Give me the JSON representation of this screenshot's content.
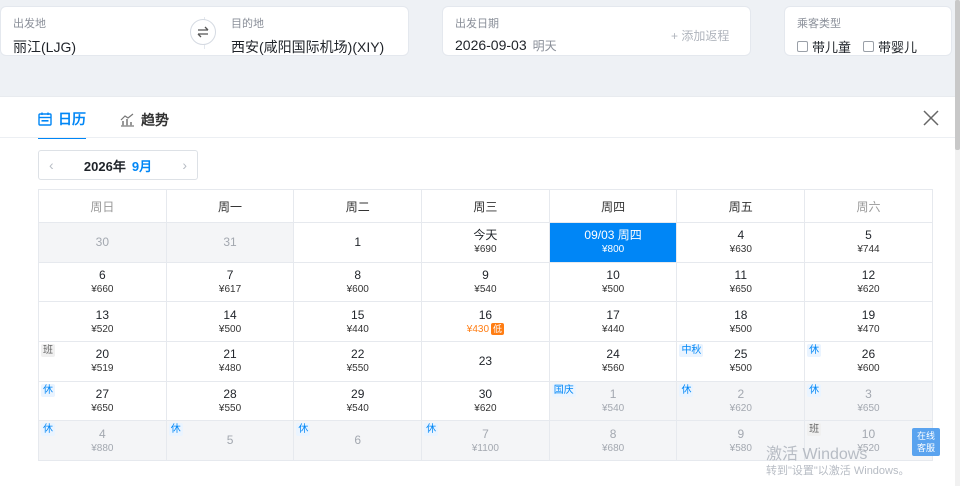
{
  "search": {
    "from_label": "出发地",
    "from_value": "丽江(LJG)",
    "to_label": "目的地",
    "to_value": "西安(咸阳国际机场)(XIY)",
    "date_label": "出发日期",
    "date_value": "2026-09-03",
    "date_sub": "明天",
    "add_return": "+ 添加返程",
    "pax_label": "乘客类型",
    "pax_child": "带儿童",
    "pax_infant": "带婴儿"
  },
  "tabs": {
    "calendar": "日历",
    "trend": "趋势"
  },
  "nav": {
    "year": "2026年",
    "month": "9月",
    "prev": "‹",
    "next": "›"
  },
  "weekdays": [
    "周日",
    "周一",
    "周二",
    "周三",
    "周四",
    "周五",
    "周六"
  ],
  "weeks": [
    [
      {
        "day": "30",
        "price": "",
        "grey": true
      },
      {
        "day": "31",
        "price": "",
        "grey": true
      },
      {
        "day": "1",
        "price": ""
      },
      {
        "day": "今天",
        "price": "¥690"
      },
      {
        "day": "09/03 周四",
        "price": "¥800",
        "selected": true
      },
      {
        "day": "4",
        "price": "¥630"
      },
      {
        "day": "5",
        "price": "¥744"
      }
    ],
    [
      {
        "day": "6",
        "price": "¥660"
      },
      {
        "day": "7",
        "price": "¥617"
      },
      {
        "day": "8",
        "price": "¥600"
      },
      {
        "day": "9",
        "price": "¥540"
      },
      {
        "day": "10",
        "price": "¥500"
      },
      {
        "day": "11",
        "price": "¥650"
      },
      {
        "day": "12",
        "price": "¥620"
      }
    ],
    [
      {
        "day": "13",
        "price": "¥520"
      },
      {
        "day": "14",
        "price": "¥500"
      },
      {
        "day": "15",
        "price": "¥440"
      },
      {
        "day": "16",
        "price": "¥430",
        "low": "低"
      },
      {
        "day": "17",
        "price": "¥440"
      },
      {
        "day": "18",
        "price": "¥500"
      },
      {
        "day": "19",
        "price": "¥470"
      }
    ],
    [
      {
        "day": "20",
        "price": "¥519",
        "tag": "班",
        "tagType": "work"
      },
      {
        "day": "21",
        "price": "¥480"
      },
      {
        "day": "22",
        "price": "¥550"
      },
      {
        "day": "23",
        "price": ""
      },
      {
        "day": "24",
        "price": "¥560"
      },
      {
        "day": "25",
        "price": "¥500",
        "tag": "中秋"
      },
      {
        "day": "26",
        "price": "¥600",
        "tag": "休"
      }
    ],
    [
      {
        "day": "27",
        "price": "¥650",
        "tag": "休"
      },
      {
        "day": "28",
        "price": "¥550"
      },
      {
        "day": "29",
        "price": "¥540"
      },
      {
        "day": "30",
        "price": "¥620"
      },
      {
        "day": "1",
        "price": "¥540",
        "grey": true,
        "tag": "国庆"
      },
      {
        "day": "2",
        "price": "¥620",
        "grey": true,
        "tag": "休"
      },
      {
        "day": "3",
        "price": "¥650",
        "grey": true,
        "tag": "休"
      }
    ],
    [
      {
        "day": "4",
        "price": "¥880",
        "grey": true,
        "tag": "休"
      },
      {
        "day": "5",
        "price": "",
        "grey": true,
        "tag": "休"
      },
      {
        "day": "6",
        "price": "",
        "grey": true,
        "tag": "休"
      },
      {
        "day": "7",
        "price": "¥1100",
        "grey": true,
        "tag": "休"
      },
      {
        "day": "8",
        "price": "¥680",
        "grey": true
      },
      {
        "day": "9",
        "price": "¥580",
        "grey": true
      },
      {
        "day": "10",
        "price": "¥520",
        "grey": true,
        "tag": "班",
        "tagType": "work"
      }
    ]
  ],
  "watermark": {
    "line1": "激活 Windows",
    "line2": "转到\"设置\"以激活 Windows。"
  },
  "service": {
    "line1": "在线",
    "line2": "客服"
  },
  "colors": {
    "accent": "#0086f6",
    "low": "#ff7d13"
  }
}
